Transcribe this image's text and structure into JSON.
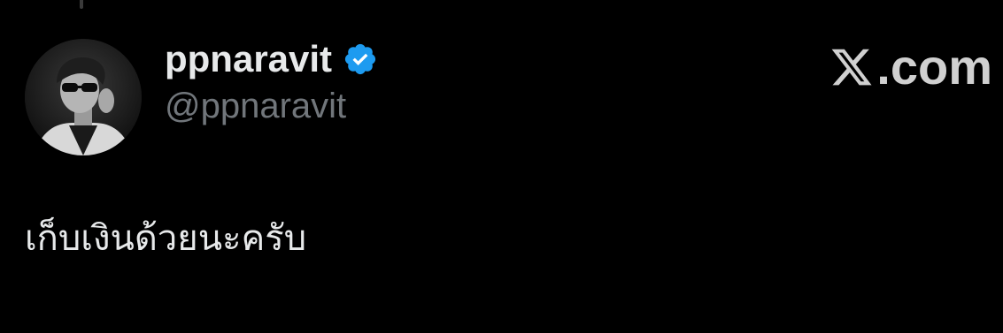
{
  "user": {
    "display_name": "ppnaravit",
    "handle": "@ppnaravit",
    "verified": true,
    "verified_color": "#1d9bf0"
  },
  "brand": {
    "logo_icon": "x-logo-icon",
    "text": ".com"
  },
  "tweet": {
    "text": "เก็บเงินด้วยนะครับ"
  },
  "colors": {
    "background": "#000000",
    "primary_text": "#e7e9ea",
    "secondary_text": "#71767b"
  }
}
